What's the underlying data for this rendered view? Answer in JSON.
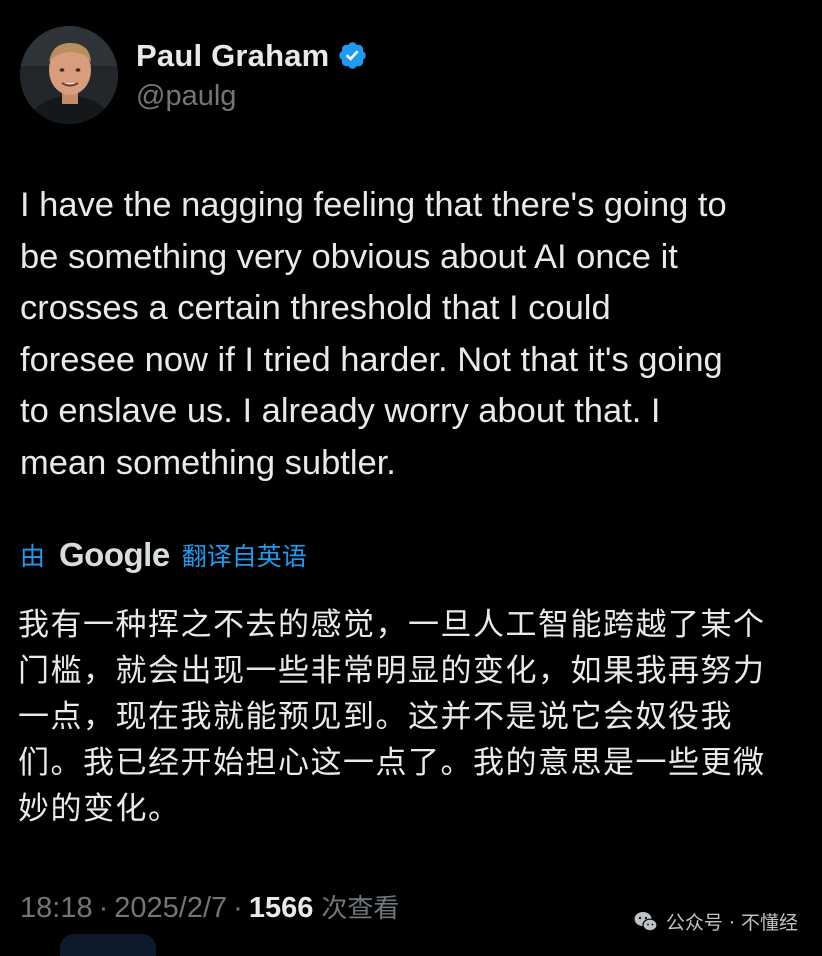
{
  "author": {
    "display_name": "Paul Graham",
    "handle": "@paulg",
    "verified": true
  },
  "tweet": {
    "text": "I have the nagging feeling that there's going to\nbe something very obvious about AI once it\ncrosses a certain threshold that I could\nforesee now if I tried harder. Not that it's going\nto enslave us. I already worry about that. I\nmean something subtler."
  },
  "translation": {
    "by_label": "由",
    "provider": "Google",
    "label": "翻译自英语",
    "text": "我有一种挥之不去的感觉，一旦人工智能跨越了某个\n门槛，就会出现一些非常明显的变化，如果我再努力\n一点，现在我就能预见到。这并不是说它会奴役我\n们。我已经开始担心这一点了。我的意思是一些更微\n妙的变化。"
  },
  "meta": {
    "time": "18:18",
    "date": "2025/2/7",
    "separator": "·",
    "views_count": "1566",
    "views_label": "次查看"
  },
  "watermark": {
    "text": "公众号 · 不懂经",
    "icon": "wechat-icon"
  },
  "colors": {
    "background": "#000000",
    "text_primary": "#e7e9ea",
    "text_secondary": "#71767b",
    "accent": "#1d9bf0"
  }
}
